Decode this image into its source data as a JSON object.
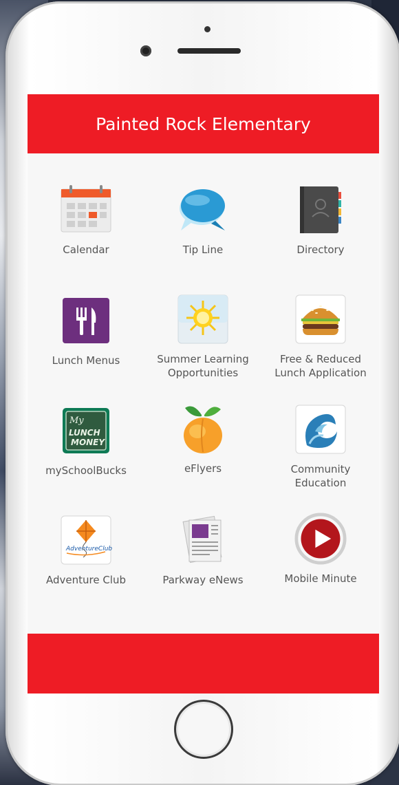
{
  "app": {
    "title": "Painted Rock Elementary"
  },
  "colors": {
    "brand_red": "#ee1c25",
    "label_gray": "#555555",
    "screen_bg": "#f7f7f7"
  },
  "tiles": [
    {
      "label": "Calendar",
      "icon": "calendar-icon"
    },
    {
      "label": "Tip Line",
      "icon": "speech-bubble-icon"
    },
    {
      "label": "Directory",
      "icon": "address-book-icon"
    },
    {
      "label": "Lunch Menus",
      "icon": "fork-knife-icon"
    },
    {
      "label": "Summer Learning\nOpportunities",
      "icon": "sun-icon"
    },
    {
      "label": "Free & Reduced\nLunch Application",
      "icon": "hamburger-icon"
    },
    {
      "label": "mySchoolBucks",
      "icon": "lunch-money-icon"
    },
    {
      "label": "eFlyers",
      "icon": "peach-icon"
    },
    {
      "label": "Community\nEducation",
      "icon": "community-education-logo-icon"
    },
    {
      "label": "Adventure Club",
      "icon": "kite-icon"
    },
    {
      "label": "Parkway eNews",
      "icon": "newspaper-icon"
    },
    {
      "label": "Mobile Minute",
      "icon": "play-button-icon"
    }
  ],
  "calendar_icon_text": "",
  "lunch_money_text": {
    "line1": "My",
    "line2": "LUNCH",
    "line3": "MONEY"
  },
  "adventure_logo_text": "AdventureClub"
}
